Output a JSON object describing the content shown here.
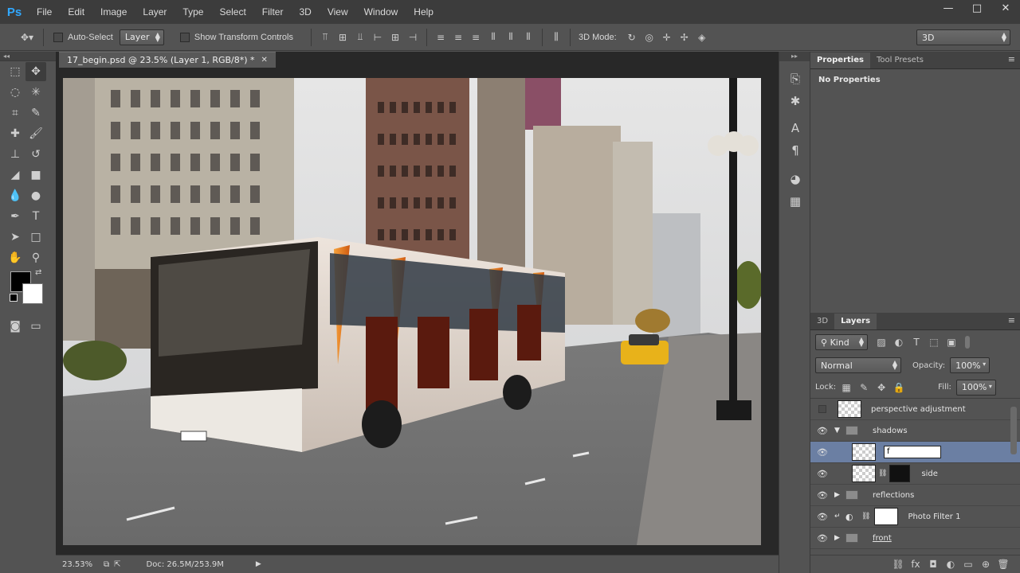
{
  "app": {
    "logo": "Ps"
  },
  "menu": [
    "File",
    "Edit",
    "Image",
    "Layer",
    "Type",
    "Select",
    "Filter",
    "3D",
    "View",
    "Window",
    "Help"
  ],
  "window_controls": [
    "—",
    "□",
    "✕"
  ],
  "options": {
    "auto_select_label": "Auto-Select",
    "auto_select_value": "Layer",
    "transform_label": "Show Transform Controls",
    "mode3d_label": "3D Mode:",
    "workspace": "3D"
  },
  "document": {
    "tab_title": "17_begin.psd @ 23.5% (Layer 1, RGB/8*) *",
    "close": "✕"
  },
  "status": {
    "zoom": "23.53%",
    "doc": "Doc: 26.5M/253.9M"
  },
  "properties": {
    "tabs": [
      "Properties",
      "Tool Presets"
    ],
    "content": "No Properties"
  },
  "layers": {
    "tabs": [
      "3D",
      "Layers"
    ],
    "kind": "Kind",
    "blend": "Normal",
    "opacity_label": "Opacity:",
    "opacity": "100%",
    "lock_label": "Lock:",
    "fill_label": "Fill:",
    "fill": "100%",
    "rows": [
      {
        "name": "perspective adjustment",
        "visible": false
      },
      {
        "name": "shadows",
        "visible": true
      },
      {
        "name": "f",
        "visible": true
      },
      {
        "name": "side",
        "visible": true
      },
      {
        "name": "reflections",
        "visible": true
      },
      {
        "name": "Photo Filter 1",
        "visible": true
      },
      {
        "name": "front",
        "visible": true
      }
    ]
  },
  "colors": {
    "accent": "#31a8ff",
    "selection": "#6b7fa3",
    "taxi": "#e8b21a",
    "bus_orange": "#f07a18"
  }
}
